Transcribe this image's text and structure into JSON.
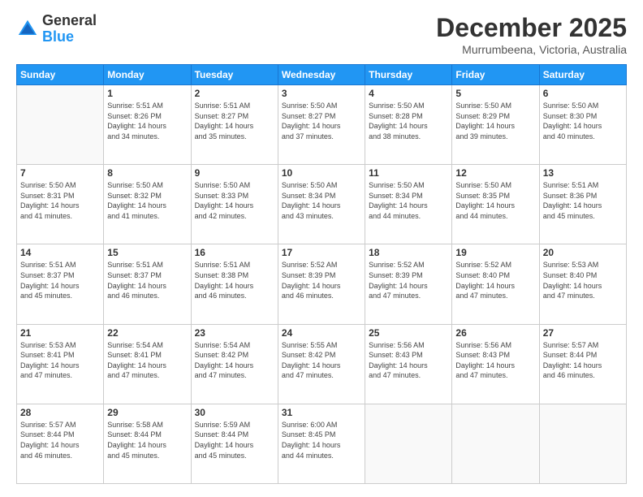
{
  "logo": {
    "line1": "General",
    "line2": "Blue"
  },
  "header": {
    "title": "December 2025",
    "location": "Murrumbeena, Victoria, Australia"
  },
  "weekdays": [
    "Sunday",
    "Monday",
    "Tuesday",
    "Wednesday",
    "Thursday",
    "Friday",
    "Saturday"
  ],
  "weeks": [
    [
      {
        "day": "",
        "sunrise": "",
        "sunset": "",
        "daylight": ""
      },
      {
        "day": "1",
        "sunrise": "Sunrise: 5:51 AM",
        "sunset": "Sunset: 8:26 PM",
        "daylight": "Daylight: 14 hours and 34 minutes."
      },
      {
        "day": "2",
        "sunrise": "Sunrise: 5:51 AM",
        "sunset": "Sunset: 8:27 PM",
        "daylight": "Daylight: 14 hours and 35 minutes."
      },
      {
        "day": "3",
        "sunrise": "Sunrise: 5:50 AM",
        "sunset": "Sunset: 8:27 PM",
        "daylight": "Daylight: 14 hours and 37 minutes."
      },
      {
        "day": "4",
        "sunrise": "Sunrise: 5:50 AM",
        "sunset": "Sunset: 8:28 PM",
        "daylight": "Daylight: 14 hours and 38 minutes."
      },
      {
        "day": "5",
        "sunrise": "Sunrise: 5:50 AM",
        "sunset": "Sunset: 8:29 PM",
        "daylight": "Daylight: 14 hours and 39 minutes."
      },
      {
        "day": "6",
        "sunrise": "Sunrise: 5:50 AM",
        "sunset": "Sunset: 8:30 PM",
        "daylight": "Daylight: 14 hours and 40 minutes."
      }
    ],
    [
      {
        "day": "7",
        "sunrise": "Sunrise: 5:50 AM",
        "sunset": "Sunset: 8:31 PM",
        "daylight": "Daylight: 14 hours and 41 minutes."
      },
      {
        "day": "8",
        "sunrise": "Sunrise: 5:50 AM",
        "sunset": "Sunset: 8:32 PM",
        "daylight": "Daylight: 14 hours and 41 minutes."
      },
      {
        "day": "9",
        "sunrise": "Sunrise: 5:50 AM",
        "sunset": "Sunset: 8:33 PM",
        "daylight": "Daylight: 14 hours and 42 minutes."
      },
      {
        "day": "10",
        "sunrise": "Sunrise: 5:50 AM",
        "sunset": "Sunset: 8:34 PM",
        "daylight": "Daylight: 14 hours and 43 minutes."
      },
      {
        "day": "11",
        "sunrise": "Sunrise: 5:50 AM",
        "sunset": "Sunset: 8:34 PM",
        "daylight": "Daylight: 14 hours and 44 minutes."
      },
      {
        "day": "12",
        "sunrise": "Sunrise: 5:50 AM",
        "sunset": "Sunset: 8:35 PM",
        "daylight": "Daylight: 14 hours and 44 minutes."
      },
      {
        "day": "13",
        "sunrise": "Sunrise: 5:51 AM",
        "sunset": "Sunset: 8:36 PM",
        "daylight": "Daylight: 14 hours and 45 minutes."
      }
    ],
    [
      {
        "day": "14",
        "sunrise": "Sunrise: 5:51 AM",
        "sunset": "Sunset: 8:37 PM",
        "daylight": "Daylight: 14 hours and 45 minutes."
      },
      {
        "day": "15",
        "sunrise": "Sunrise: 5:51 AM",
        "sunset": "Sunset: 8:37 PM",
        "daylight": "Daylight: 14 hours and 46 minutes."
      },
      {
        "day": "16",
        "sunrise": "Sunrise: 5:51 AM",
        "sunset": "Sunset: 8:38 PM",
        "daylight": "Daylight: 14 hours and 46 minutes."
      },
      {
        "day": "17",
        "sunrise": "Sunrise: 5:52 AM",
        "sunset": "Sunset: 8:39 PM",
        "daylight": "Daylight: 14 hours and 46 minutes."
      },
      {
        "day": "18",
        "sunrise": "Sunrise: 5:52 AM",
        "sunset": "Sunset: 8:39 PM",
        "daylight": "Daylight: 14 hours and 47 minutes."
      },
      {
        "day": "19",
        "sunrise": "Sunrise: 5:52 AM",
        "sunset": "Sunset: 8:40 PM",
        "daylight": "Daylight: 14 hours and 47 minutes."
      },
      {
        "day": "20",
        "sunrise": "Sunrise: 5:53 AM",
        "sunset": "Sunset: 8:40 PM",
        "daylight": "Daylight: 14 hours and 47 minutes."
      }
    ],
    [
      {
        "day": "21",
        "sunrise": "Sunrise: 5:53 AM",
        "sunset": "Sunset: 8:41 PM",
        "daylight": "Daylight: 14 hours and 47 minutes."
      },
      {
        "day": "22",
        "sunrise": "Sunrise: 5:54 AM",
        "sunset": "Sunset: 8:41 PM",
        "daylight": "Daylight: 14 hours and 47 minutes."
      },
      {
        "day": "23",
        "sunrise": "Sunrise: 5:54 AM",
        "sunset": "Sunset: 8:42 PM",
        "daylight": "Daylight: 14 hours and 47 minutes."
      },
      {
        "day": "24",
        "sunrise": "Sunrise: 5:55 AM",
        "sunset": "Sunset: 8:42 PM",
        "daylight": "Daylight: 14 hours and 47 minutes."
      },
      {
        "day": "25",
        "sunrise": "Sunrise: 5:56 AM",
        "sunset": "Sunset: 8:43 PM",
        "daylight": "Daylight: 14 hours and 47 minutes."
      },
      {
        "day": "26",
        "sunrise": "Sunrise: 5:56 AM",
        "sunset": "Sunset: 8:43 PM",
        "daylight": "Daylight: 14 hours and 47 minutes."
      },
      {
        "day": "27",
        "sunrise": "Sunrise: 5:57 AM",
        "sunset": "Sunset: 8:44 PM",
        "daylight": "Daylight: 14 hours and 46 minutes."
      }
    ],
    [
      {
        "day": "28",
        "sunrise": "Sunrise: 5:57 AM",
        "sunset": "Sunset: 8:44 PM",
        "daylight": "Daylight: 14 hours and 46 minutes."
      },
      {
        "day": "29",
        "sunrise": "Sunrise: 5:58 AM",
        "sunset": "Sunset: 8:44 PM",
        "daylight": "Daylight: 14 hours and 45 minutes."
      },
      {
        "day": "30",
        "sunrise": "Sunrise: 5:59 AM",
        "sunset": "Sunset: 8:44 PM",
        "daylight": "Daylight: 14 hours and 45 minutes."
      },
      {
        "day": "31",
        "sunrise": "Sunrise: 6:00 AM",
        "sunset": "Sunset: 8:45 PM",
        "daylight": "Daylight: 14 hours and 44 minutes."
      },
      {
        "day": "",
        "sunrise": "",
        "sunset": "",
        "daylight": ""
      },
      {
        "day": "",
        "sunrise": "",
        "sunset": "",
        "daylight": ""
      },
      {
        "day": "",
        "sunrise": "",
        "sunset": "",
        "daylight": ""
      }
    ]
  ]
}
